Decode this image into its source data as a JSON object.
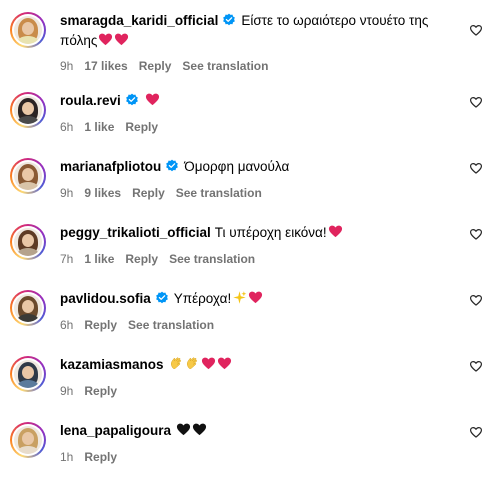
{
  "comments": [
    {
      "username": "smaragda_karidi_official",
      "verified": true,
      "text": "Είστε το ωραιότερο ντουέτο της πόλης",
      "emojis": [
        "red-heart",
        "red-heart"
      ],
      "time": "9h",
      "likes": "17 likes",
      "reply": "Reply",
      "translate": "See translation",
      "hair": "#c98c4a",
      "shirt": "#e9e3b0"
    },
    {
      "username": "roula.revi",
      "verified": true,
      "text": "",
      "emojis": [
        "red-heart"
      ],
      "time": "6h",
      "likes": "1 like",
      "reply": "Reply",
      "translate": "",
      "hair": "#2b2322",
      "shirt": "#4a4a4a"
    },
    {
      "username": "marianafpliotou",
      "verified": true,
      "text": "Όμορφη μανούλα",
      "emojis": [],
      "time": "9h",
      "likes": "9 likes",
      "reply": "Reply",
      "translate": "See translation",
      "hair": "#8a5a34",
      "shirt": "#d9c4a8"
    },
    {
      "username": "peggy_trikalioti_official",
      "verified": false,
      "text": "Τι υπέροχη εικόνα!",
      "emojis": [
        "red-heart"
      ],
      "time": "7h",
      "likes": "1 like",
      "reply": "Reply",
      "translate": "See translation",
      "hair": "#5e3b24",
      "shirt": "#b5a38c"
    },
    {
      "username": "pavlidou.sofia",
      "verified": true,
      "text": "Υπέροχα!",
      "emojis": [
        "sparkles",
        "red-heart"
      ],
      "time": "6h",
      "likes": "",
      "reply": "Reply",
      "translate": "See translation",
      "hair": "#6b4a2c",
      "shirt": "#3b3a36"
    },
    {
      "username": "kazamiasmanos",
      "verified": false,
      "text": "",
      "emojis": [
        "clapping-hands",
        "clapping-hands",
        "red-heart",
        "red-heart"
      ],
      "time": "9h",
      "likes": "",
      "reply": "Reply",
      "translate": "",
      "hair": "#2f3a48",
      "shirt": "#5b7b9c"
    },
    {
      "username": "lena_papaligoura",
      "verified": false,
      "text": "",
      "emojis": [
        "black-heart",
        "black-heart"
      ],
      "time": "1h",
      "likes": "",
      "reply": "Reply",
      "translate": "",
      "hair": "#c9a062",
      "shirt": "#e8dccb"
    }
  ],
  "colors": {
    "verified": "#0095f6",
    "meta": "#737373",
    "red_heart": "#e0245e",
    "black_heart": "#111111"
  }
}
